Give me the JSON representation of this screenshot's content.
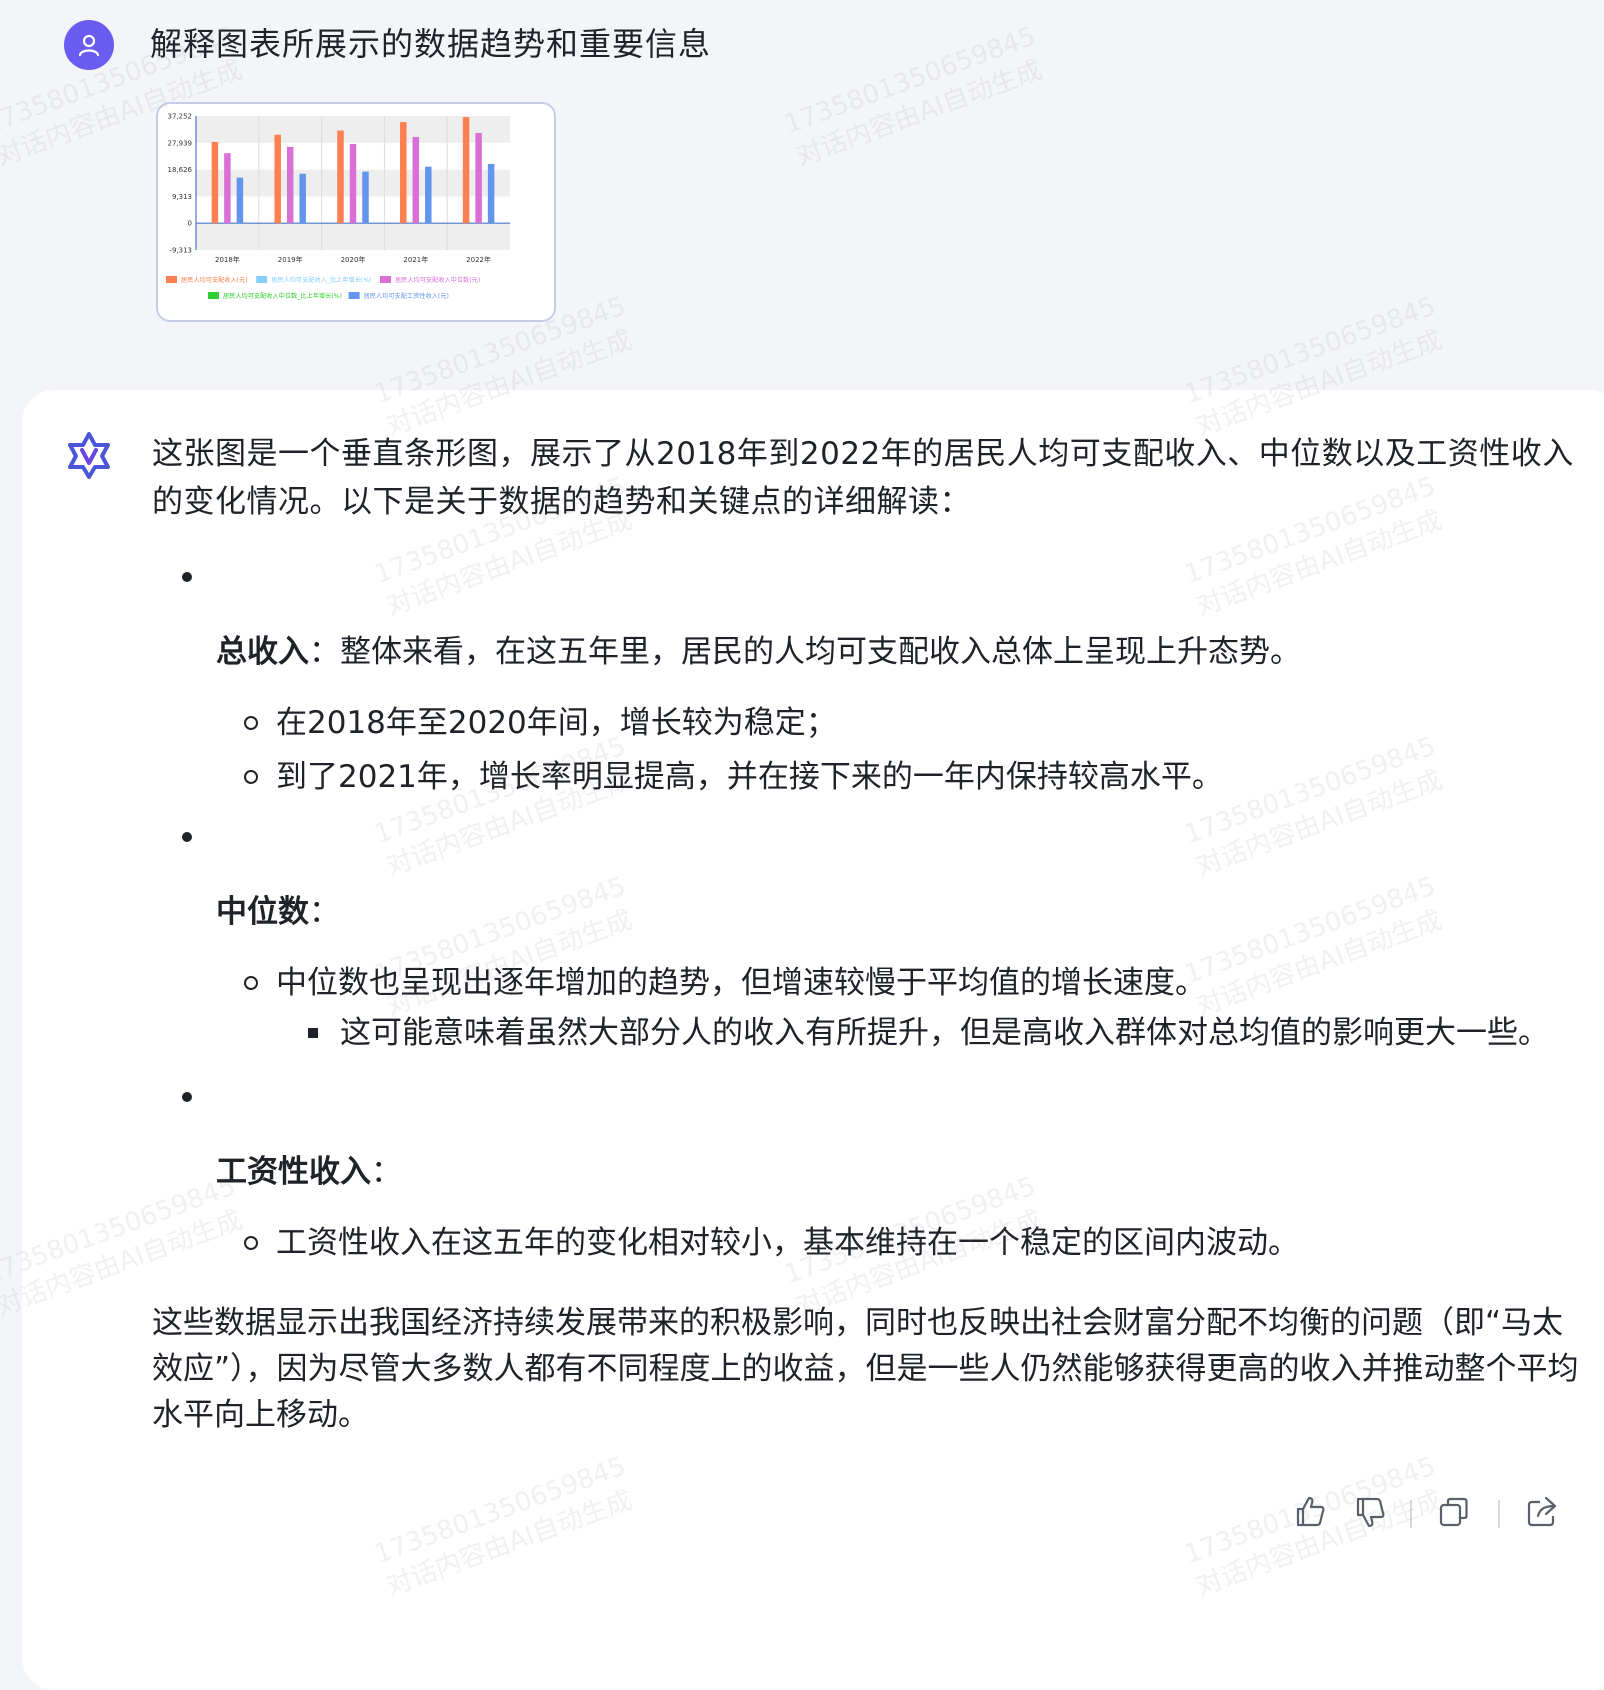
{
  "user": {
    "avatar": "user-icon",
    "prompt": "解释图表所展示的数据趋势和重要信息"
  },
  "attachment": {
    "chart_data": {
      "type": "bar",
      "categories": [
        "2018年",
        "2019年",
        "2020年",
        "2021年",
        "2022年"
      ],
      "yticks": [
        "37,252",
        "27,939",
        "18,626",
        "9,313",
        "0",
        "-9,313"
      ],
      "ylim": [
        -9313,
        37252
      ],
      "series": [
        {
          "name": "居民人均可支配收入(元)",
          "color": "#ff7f50",
          "values": [
            28228,
            30733,
            32189,
            35128,
            36883
          ]
        },
        {
          "name": "居民人均可支配收入_比上年增长(%)",
          "color": "#87cefa",
          "values": [
            6.5,
            5.8,
            2.1,
            8.1,
            2.9
          ]
        },
        {
          "name": "居民人均可支配收入中位数(元)",
          "color": "#da70d6",
          "values": [
            24336,
            26523,
            27540,
            29975,
            31370
          ]
        },
        {
          "name": "居民人均可支配收入中位数_比上年增长(%)",
          "color": "#32cd32",
          "values": [
            8.6,
            9.0,
            3.8,
            8.8,
            4.7
          ]
        },
        {
          "name": "居民人均可支配工资性收入(元)",
          "color": "#6495ed",
          "values": [
            15829,
            17186,
            17917,
            19629,
            20590
          ]
        }
      ]
    }
  },
  "assistant": {
    "avatar": "assistant-logo-icon",
    "intro": "这张图是一个垂直条形图，展示了从2018年到2022年的居民人均可支配收入、中位数以及工资性收入的变化情况。以下是关于数据的趋势和关键点的详细解读：",
    "sections": [
      {
        "title": "总收入",
        "title_suffix": "：整体来看，在这五年里，居民的人均可支配收入总体上呈现上升态势。",
        "items": [
          {
            "text": "在2018年至2020年间，增长较为稳定；"
          },
          {
            "text": "到了2021年，增长率明显提高，并在接下来的一年内保持较高水平。"
          }
        ]
      },
      {
        "title": "中位数",
        "title_suffix": "：",
        "items": [
          {
            "text": "中位数也呈现出逐年增加的趋势，但增速较慢于平均值的增长速度。"
          }
        ],
        "subitems": [
          {
            "text": "这可能意味着虽然大部分人的收入有所提升，但是高收入群体对总均值的影响更大一些。"
          }
        ]
      },
      {
        "title": "工资性收入",
        "title_suffix": "：",
        "items": [
          {
            "text": "工资性收入在这五年的变化相对较小，基本维持在一个稳定的区间内波动。"
          }
        ]
      }
    ],
    "conclusion": "这些数据显示出我国经济持续发展带来的积极影响，同时也反映出社会财富分配不均衡的问题（即“马太效应”），因为尽管大多数人都有不同程度上的收益，但是一些人仍然能够获得更高的收入并推动整个平均水平向上移动。"
  },
  "actions": [
    {
      "name": "like-button",
      "icon": "thumbs-up-icon"
    },
    {
      "name": "dislike-button",
      "icon": "thumbs-down-icon"
    },
    {
      "name": "copy-button",
      "icon": "copy-icon"
    },
    {
      "name": "share-button",
      "icon": "share-icon"
    }
  ],
  "watermark": {
    "line1": "17358013506598 45",
    "line2": "对话内容由AI自动生成"
  }
}
